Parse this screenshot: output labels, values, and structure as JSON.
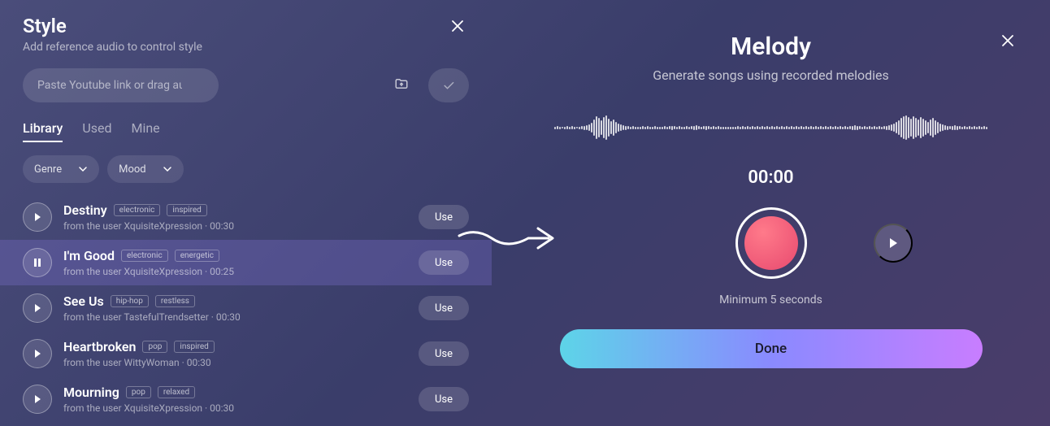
{
  "style_panel": {
    "title": "Style",
    "subtitle": "Add reference audio to control style",
    "input_placeholder": "Paste Youtube link or drag audio file here",
    "tabs": [
      {
        "label": "Library",
        "active": true
      },
      {
        "label": "Used",
        "active": false
      },
      {
        "label": "Mine",
        "active": false
      }
    ],
    "filters": [
      {
        "label": "Genre"
      },
      {
        "label": "Mood"
      }
    ],
    "use_label": "Use",
    "items": [
      {
        "title": "Destiny",
        "tags": [
          "electronic",
          "inspired"
        ],
        "user": "XquisiteXpression",
        "duration": "00:30",
        "playing": false,
        "active": false
      },
      {
        "title": "I'm Good",
        "tags": [
          "electronic",
          "energetic"
        ],
        "user": "XquisiteXpression",
        "duration": "00:25",
        "playing": true,
        "active": true
      },
      {
        "title": "See Us",
        "tags": [
          "hip-hop",
          "restless"
        ],
        "user": "TastefulTrendsetter",
        "duration": "00:30",
        "playing": false,
        "active": false
      },
      {
        "title": "Heartbroken",
        "tags": [
          "pop",
          "inspired"
        ],
        "user": "WittyWoman",
        "duration": "00:30",
        "playing": false,
        "active": false
      },
      {
        "title": "Mourning",
        "tags": [
          "pop",
          "relaxed"
        ],
        "user": "XquisiteXpression",
        "duration": "00:30",
        "playing": false,
        "active": false
      }
    ],
    "meta_prefix": "from the user "
  },
  "melody_panel": {
    "title": "Melody",
    "subtitle": "Generate songs using recorded melodies",
    "timer": "00:00",
    "min_seconds": "Minimum 5 seconds",
    "done_label": "Done"
  }
}
